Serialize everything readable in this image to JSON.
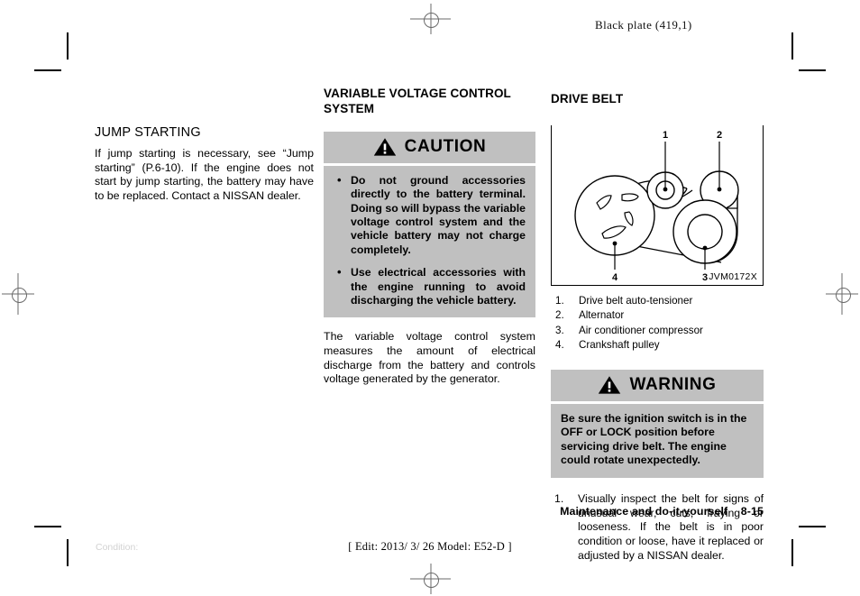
{
  "header": {
    "black_plate": "Black plate (419,1)"
  },
  "left_column": {
    "title": "JUMP STARTING",
    "paragraph": "If jump starting is necessary, see “Jump starting” (P.6-10). If the engine does not start by jump starting, the battery may have to be replaced. Contact a NISSAN dealer."
  },
  "middle_column": {
    "title": "VARIABLE VOLTAGE CONTROL SYSTEM",
    "caution": {
      "label": "CAUTION",
      "icon": "warning-triangle-icon",
      "bullets": [
        "Do not ground accessories directly to the battery terminal. Doing so will bypass the variable voltage control system and the vehicle battery may not charge completely.",
        "Use electrical accessories with the engine running to avoid discharging the vehicle battery."
      ]
    },
    "paragraph": "The variable voltage control system measures the amount of electrical discharge from the battery and controls voltage generated by the generator."
  },
  "right_column": {
    "title": "DRIVE BELT",
    "figure": {
      "id": "JVM0172X",
      "callouts": [
        "1",
        "2",
        "3",
        "4"
      ]
    },
    "legend": [
      {
        "num": "1.",
        "text": "Drive belt auto-tensioner"
      },
      {
        "num": "2.",
        "text": "Alternator"
      },
      {
        "num": "3.",
        "text": "Air conditioner compressor"
      },
      {
        "num": "4.",
        "text": "Crankshaft pulley"
      }
    ],
    "warning": {
      "label": "WARNING",
      "icon": "warning-triangle-icon",
      "text": "Be sure the ignition switch is in the OFF or LOCK position before servicing drive belt. The engine could rotate unexpectedly."
    },
    "steps": [
      {
        "num": "1.",
        "text": "Visually inspect the belt for signs of unusual wear, cuts, fraying or looseness. If the belt is in poor condition or loose, have it replaced or adjusted by a NISSAN dealer."
      }
    ]
  },
  "footer": {
    "chapter": "Maintenance and do-it-yourself",
    "page": "8-15",
    "condition": "Condition:",
    "edit_info": "[ Edit: 2013/ 3/ 26   Model: E52-D ]"
  }
}
